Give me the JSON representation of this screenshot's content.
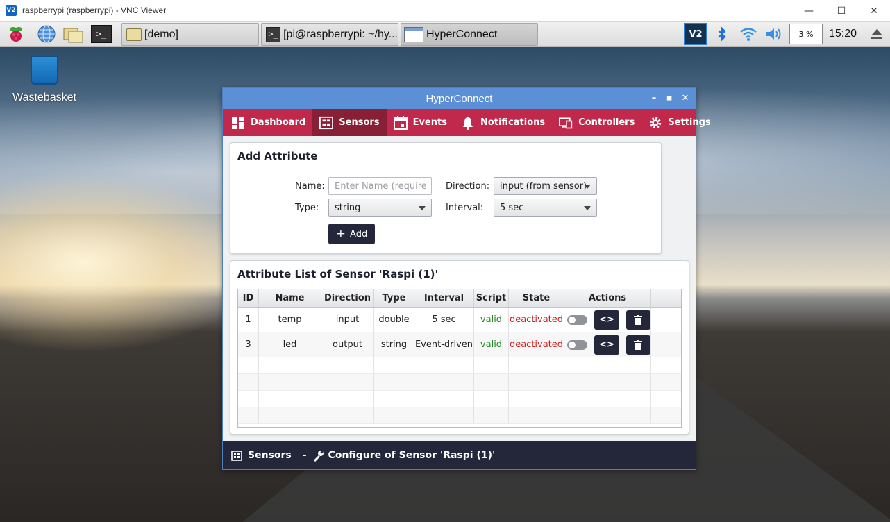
{
  "vnc": {
    "logo": "V2",
    "title": "raspberrypi (raspberrypi) - VNC Viewer",
    "controls": {
      "minimize": "—",
      "maximize": "☐",
      "close": "✕"
    }
  },
  "taskbar": {
    "launchers": [
      "raspberry-menu-icon",
      "web-browser-icon",
      "file-manager-icon",
      "terminal-icon"
    ],
    "tasks": [
      {
        "label": "[demo]",
        "icon": "folder-icon"
      },
      {
        "label": "[pi@raspberrypi: ~/hy...",
        "icon": "terminal-icon"
      },
      {
        "label": "HyperConnect",
        "icon": "window-icon"
      }
    ],
    "tray": {
      "vnc_icon": "V2",
      "cpu": "3 %",
      "clock": "15:20"
    }
  },
  "desktop": {
    "wastebasket_label": "Wastebasket"
  },
  "app": {
    "title": "HyperConnect",
    "nav": [
      {
        "label": "Dashboard",
        "icon": "dashboard-icon"
      },
      {
        "label": "Sensors",
        "icon": "sensors-icon",
        "active": true
      },
      {
        "label": "Events",
        "icon": "calendar-icon"
      },
      {
        "label": "Notifications",
        "icon": "bell-icon"
      },
      {
        "label": "Controllers",
        "icon": "controllers-icon"
      },
      {
        "label": "Settings",
        "icon": "gear-icon"
      }
    ],
    "add_attribute": {
      "title": "Add Attribute",
      "name_label": "Name:",
      "name_placeholder": "Enter Name (required)",
      "type_label": "Type:",
      "type_value": "string",
      "direction_label": "Direction:",
      "direction_value": "input (from sensor)",
      "interval_label": "Interval:",
      "interval_value": "5 sec",
      "add_button": "Add"
    },
    "attribute_list": {
      "title": "Attribute List of Sensor 'Raspi (1)'",
      "columns": [
        "ID",
        "Name",
        "Direction",
        "Type",
        "Interval",
        "Script",
        "State",
        "Actions"
      ],
      "rows": [
        {
          "id": "1",
          "name": "temp",
          "direction": "input",
          "type": "double",
          "interval": "5 sec",
          "script": "valid",
          "state": "deactivated"
        },
        {
          "id": "3",
          "name": "led",
          "direction": "output",
          "type": "string",
          "interval": "Event-driven",
          "script": "valid",
          "state": "deactivated"
        }
      ],
      "script_button": "<>"
    },
    "status": {
      "section": "Sensors",
      "separator": "-",
      "page": "Configure of Sensor 'Raspi (1)'"
    },
    "colors": {
      "titlebar": "#5b8fd6",
      "nav": "#c0294c",
      "nav_active": "#872037",
      "dark": "#24273a",
      "valid": "#1e8a1e",
      "deactivated": "#d01c1c"
    }
  }
}
